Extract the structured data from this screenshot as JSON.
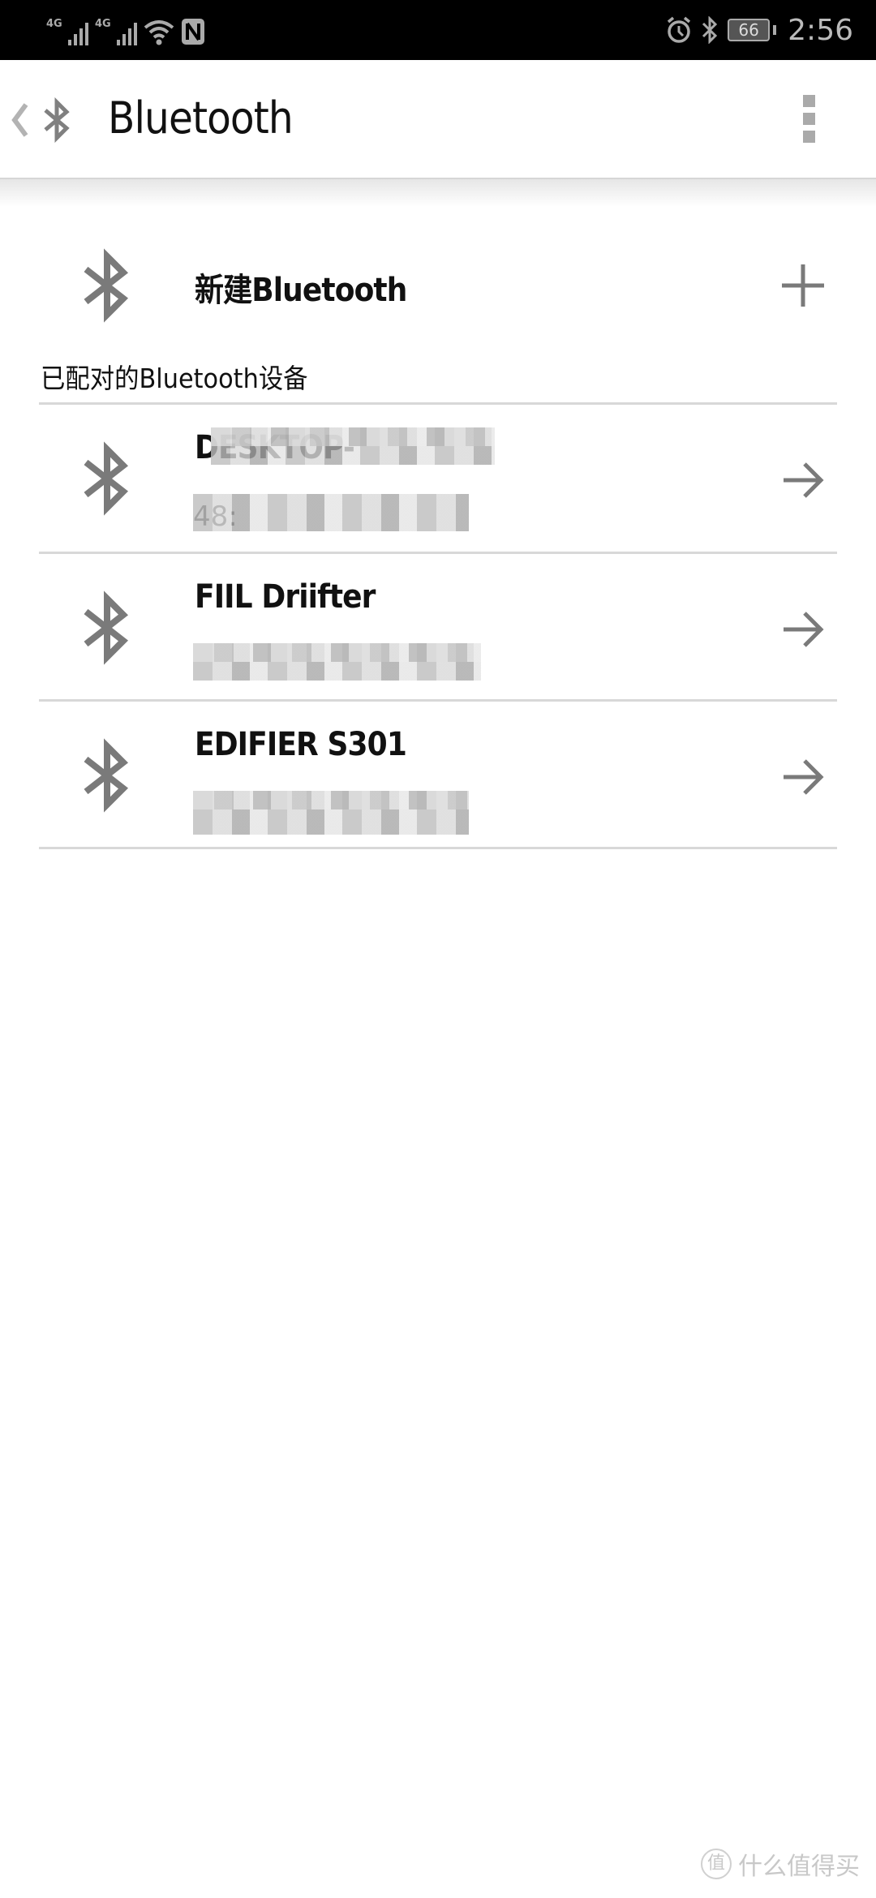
{
  "status_bar": {
    "sim1_tag": "4G",
    "sim2_tag": "4G",
    "icons_left": [
      "signal-icon",
      "signal-icon",
      "wifi-icon",
      "nfc-icon"
    ],
    "icons_right": [
      "alarm-icon",
      "bluetooth-icon",
      "battery-icon"
    ],
    "battery": "66",
    "time": "2:56"
  },
  "app_bar": {
    "title": "Bluetooth",
    "back_icon": "back-chevron-icon",
    "app_icon": "bluetooth-icon",
    "menu_icon": "more-vert-icon"
  },
  "new_device": {
    "label": "新建Bluetooth",
    "icon": "bluetooth-icon",
    "action_icon": "plus-icon"
  },
  "paired_section": {
    "title": "已配对的Bluetooth设备",
    "devices": [
      {
        "name": "DESKTOP-",
        "address": "48:",
        "name_redacted": true,
        "address_redacted": true
      },
      {
        "name": "FIIL Driifter",
        "address": "",
        "address_redacted": true
      },
      {
        "name": "EDIFIER S301",
        "address": "",
        "address_redacted": true
      }
    ]
  },
  "watermark": {
    "badge": "值",
    "text": "什么值得买"
  },
  "colors": {
    "icon_gray": "#7a7a7a",
    "divider": "#d8d8d8",
    "status_bar_bg": "#000000"
  }
}
